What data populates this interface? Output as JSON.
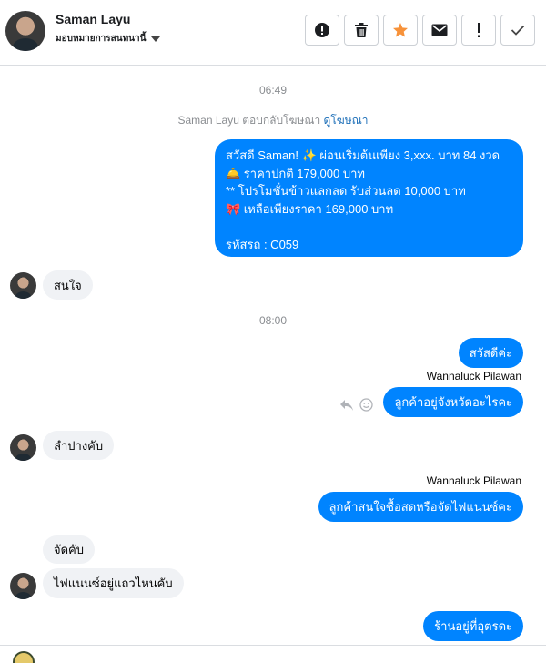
{
  "header": {
    "contact_name": "Saman Layu",
    "assigned_label": "มอบหมายการสนทนานี้",
    "buttons": [
      {
        "name": "report",
        "icon": "exclamation-circle-icon"
      },
      {
        "name": "delete",
        "icon": "trash-icon"
      },
      {
        "name": "star",
        "icon": "star-icon",
        "color": "#f7923a"
      },
      {
        "name": "mark-unread",
        "icon": "envelope-icon"
      },
      {
        "name": "important",
        "icon": "exclamation-icon"
      },
      {
        "name": "done",
        "icon": "check-icon"
      }
    ]
  },
  "thread": {
    "time_1": "06:49",
    "reply_note_prefix": "Saman Layu ตอบกลับโฆษณา",
    "reply_note_link": "ดูโฆษณา",
    "promo": {
      "line1": "สวัสดี Saman! ✨  ผ่อนเริ่มต้นเพียง 3,xxx. บาท 84 งวด",
      "line2": "🛎️ ราคาปกติ 179,000 บาท",
      "line3": "** โปรโมชั่นข้าวแลกลด รับส่วนลด 10,000 บาท",
      "line4": "🎀  เหลือเพียงราคา 169,000 บาท",
      "line5": "",
      "line6": " รหัสรถ : C059"
    },
    "in_1": "สนใจ",
    "time_2": "08:00",
    "out_1": "สวัสดีค่ะ",
    "sender_1": "Wannaluck Pilawan",
    "out_2": "ลูกค้าอยู่จังหวัดอะไรคะ",
    "in_2": "ลำปางคับ",
    "sender_2": "Wannaluck Pilawan",
    "out_3": "ลูกค้าสนใจซื้อสดหรือจัดไฟแนนซ์คะ",
    "in_3": "จัดคับ",
    "in_4": "ไฟแนนซ์อยู่แถวไหนคับ",
    "out_4": "ร้านอยู่ที่อุตรดะ"
  },
  "colors": {
    "outgoing_bubble": "#0084ff",
    "incoming_bubble": "#f0f2f5",
    "link": "#1d6fb8"
  }
}
